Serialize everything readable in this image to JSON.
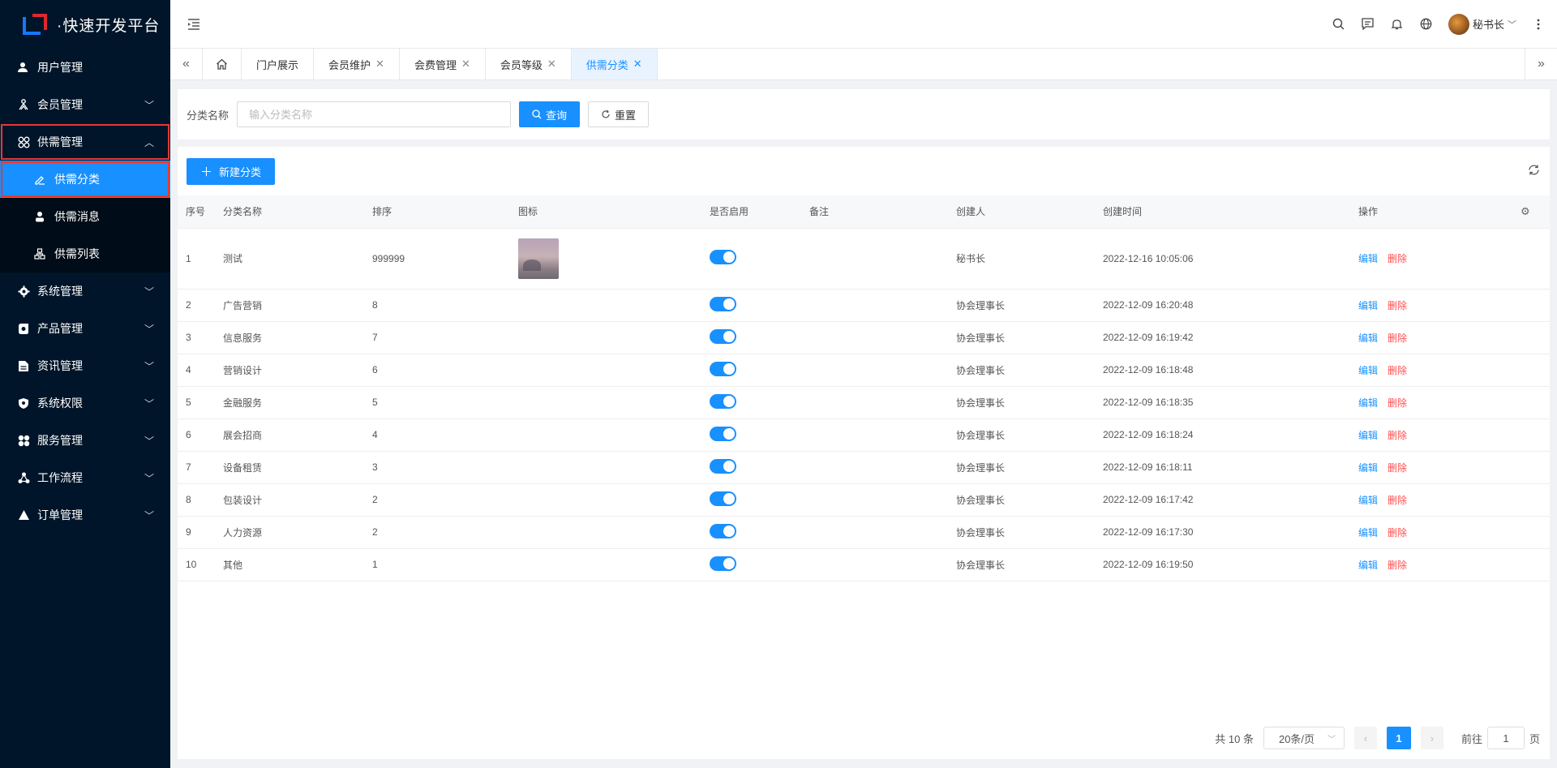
{
  "app": {
    "title": "·快速开发平台"
  },
  "sidebar": {
    "items": [
      {
        "label": "用户管理",
        "icon": "user-icon",
        "has_children": false
      },
      {
        "label": "会员管理",
        "icon": "members-icon",
        "has_children": true
      },
      {
        "label": "供需管理",
        "icon": "grid-icon",
        "has_children": true,
        "expanded": true,
        "children": [
          {
            "label": "供需分类",
            "icon": "edit-icon",
            "active": true
          },
          {
            "label": "供需消息",
            "icon": "person-icon"
          },
          {
            "label": "供需列表",
            "icon": "org-icon"
          }
        ]
      },
      {
        "label": "系统管理",
        "icon": "settings-icon",
        "has_children": true
      },
      {
        "label": "产品管理",
        "icon": "product-icon",
        "has_children": true
      },
      {
        "label": "资讯管理",
        "icon": "document-icon",
        "has_children": true
      },
      {
        "label": "系统权限",
        "icon": "shield-icon",
        "has_children": true
      },
      {
        "label": "服务管理",
        "icon": "clover-icon",
        "has_children": true
      },
      {
        "label": "工作流程",
        "icon": "workflow-icon",
        "has_children": true
      },
      {
        "label": "订单管理",
        "icon": "triangle-icon",
        "has_children": true
      }
    ]
  },
  "header": {
    "user_name": "秘书长"
  },
  "tabs": [
    {
      "label": "门户展示",
      "closable": false
    },
    {
      "label": "会员维护",
      "closable": true
    },
    {
      "label": "会费管理",
      "closable": true
    },
    {
      "label": "会员等级",
      "closable": true
    },
    {
      "label": "供需分类",
      "closable": true,
      "active": true
    }
  ],
  "search": {
    "label": "分类名称",
    "placeholder": "输入分类名称",
    "query_label": "查询",
    "reset_label": "重置"
  },
  "toolbar": {
    "new_label": "新建分类"
  },
  "table": {
    "columns": [
      "序号",
      "分类名称",
      "排序",
      "图标",
      "是否启用",
      "备注",
      "创建人",
      "创建时间",
      "操作"
    ],
    "edit_label": "编辑",
    "delete_label": "删除",
    "rows": [
      {
        "no": "1",
        "name": "测试",
        "sort": "999999",
        "has_icon": true,
        "enabled": true,
        "remark": "",
        "creator": "秘书长",
        "created": "2022-12-16 10:05:06"
      },
      {
        "no": "2",
        "name": "广告营销",
        "sort": "8",
        "has_icon": false,
        "enabled": true,
        "remark": "",
        "creator": "协会理事长",
        "created": "2022-12-09 16:20:48"
      },
      {
        "no": "3",
        "name": "信息服务",
        "sort": "7",
        "has_icon": false,
        "enabled": true,
        "remark": "",
        "creator": "协会理事长",
        "created": "2022-12-09 16:19:42"
      },
      {
        "no": "4",
        "name": "营销设计",
        "sort": "6",
        "has_icon": false,
        "enabled": true,
        "remark": "",
        "creator": "协会理事长",
        "created": "2022-12-09 16:18:48"
      },
      {
        "no": "5",
        "name": "金融服务",
        "sort": "5",
        "has_icon": false,
        "enabled": true,
        "remark": "",
        "creator": "协会理事长",
        "created": "2022-12-09 16:18:35"
      },
      {
        "no": "6",
        "name": "展会招商",
        "sort": "4",
        "has_icon": false,
        "enabled": true,
        "remark": "",
        "creator": "协会理事长",
        "created": "2022-12-09 16:18:24"
      },
      {
        "no": "7",
        "name": "设备租赁",
        "sort": "3",
        "has_icon": false,
        "enabled": true,
        "remark": "",
        "creator": "协会理事长",
        "created": "2022-12-09 16:18:11"
      },
      {
        "no": "8",
        "name": "包装设计",
        "sort": "2",
        "has_icon": false,
        "enabled": true,
        "remark": "",
        "creator": "协会理事长",
        "created": "2022-12-09 16:17:42"
      },
      {
        "no": "9",
        "name": "人力资源",
        "sort": "2",
        "has_icon": false,
        "enabled": true,
        "remark": "",
        "creator": "协会理事长",
        "created": "2022-12-09 16:17:30"
      },
      {
        "no": "10",
        "name": "其他",
        "sort": "1",
        "has_icon": false,
        "enabled": true,
        "remark": "",
        "creator": "协会理事长",
        "created": "2022-12-09 16:19:50"
      }
    ]
  },
  "pagination": {
    "total_label": "共 10 条",
    "page_size_label": "20条/页",
    "current_page": "1",
    "goto_label": "前往",
    "goto_value": "1",
    "page_unit": "页"
  },
  "colors": {
    "sidebar_bg": "#001529",
    "primary": "#1890ff",
    "danger": "#ff4d4f",
    "highlight_outline": "#e53935"
  }
}
